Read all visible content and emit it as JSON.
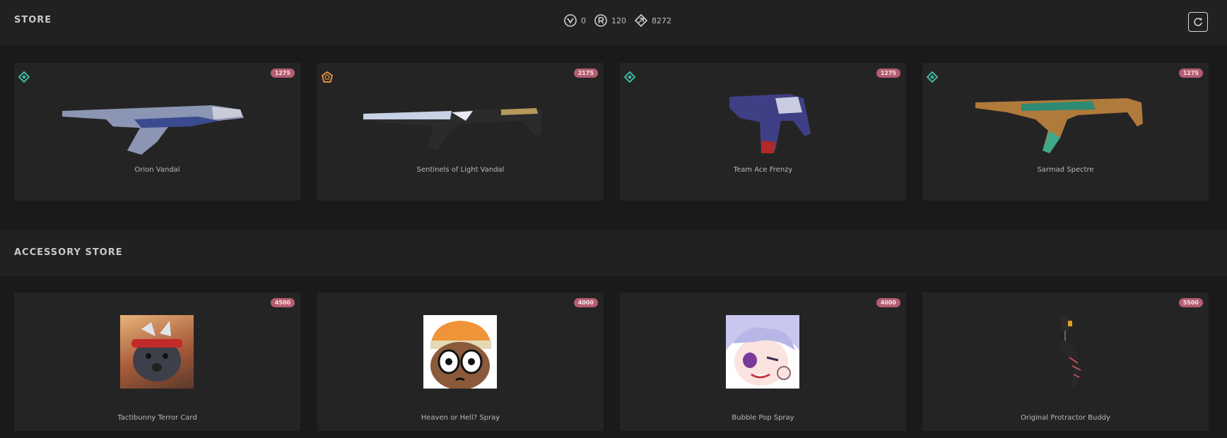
{
  "store": {
    "title": "STORE"
  },
  "wallet": [
    {
      "icon": "valorant-points-icon",
      "value": "0"
    },
    {
      "icon": "radianite-icon",
      "value": "120"
    },
    {
      "icon": "kingdom-credits-icon",
      "value": "8272"
    }
  ],
  "refresh": {
    "icon": "refresh-icon"
  },
  "offers": [
    {
      "name": "Orion Vandal",
      "price": "1275",
      "tier": "select-tier-icon",
      "tier_color": "#3fb9a2"
    },
    {
      "name": "Sentinels of Light Vandal",
      "price": "2175",
      "tier": "ultra-tier-icon",
      "tier_color": "#e0903a"
    },
    {
      "name": "Team Ace Frenzy",
      "price": "1275",
      "tier": "select-tier-icon",
      "tier_color": "#3fb9a2"
    },
    {
      "name": "Sarmad Spectre",
      "price": "1275",
      "tier": "select-tier-icon",
      "tier_color": "#3fb9a2"
    }
  ],
  "accessory_store": {
    "title": "ACCESSORY STORE"
  },
  "accessories": [
    {
      "name": "Tactibunny Terror Card",
      "price": "4500"
    },
    {
      "name": "Heaven or Hell? Spray",
      "price": "4000"
    },
    {
      "name": "Bubble Pop Spray",
      "price": "4000"
    },
    {
      "name": "Original Protractor Buddy",
      "price": "5500"
    }
  ],
  "colors": {
    "price_badge": "#b55d70",
    "card_bg": "#252425",
    "page_bg": "#1b1a1b"
  }
}
